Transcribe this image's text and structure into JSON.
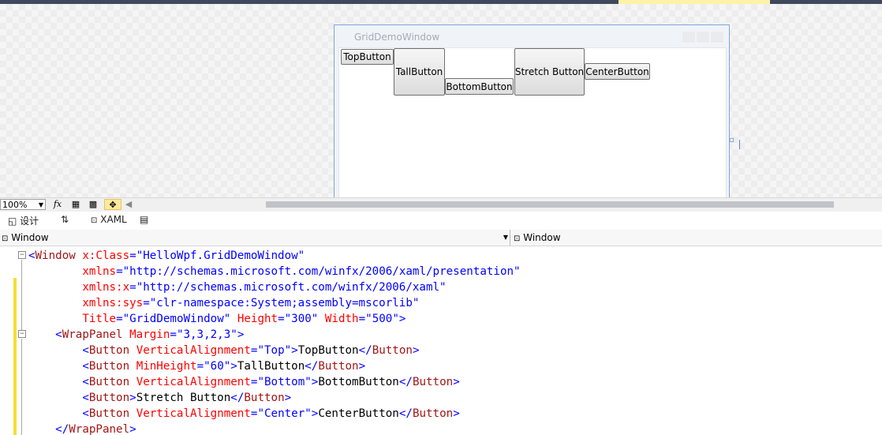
{
  "designer": {
    "window_title": "GridDemoWindow",
    "buttons": [
      {
        "label": "TopButton"
      },
      {
        "label": "TallButton"
      },
      {
        "label": "BottomButton"
      },
      {
        "label": "Stretch Button"
      },
      {
        "label": "CenterButton"
      }
    ]
  },
  "zoom": {
    "value": "100%",
    "fx_icon": "fx"
  },
  "tabs": {
    "design": "设计",
    "swap_icon": "⇅",
    "xaml": "XAML"
  },
  "navbar": {
    "left": "Window",
    "right": "Window"
  },
  "colors": {
    "tag": "#a31515",
    "attr": "#ff0000",
    "bracket": "#0000ff",
    "changebar": "#f2e033"
  },
  "code": {
    "l1": {
      "tag": "Window",
      "attr": "x:Class",
      "val": "\"HelloWpf.GridDemoWindow\""
    },
    "l2": {
      "attr": "xmlns",
      "val": "\"http://schemas.microsoft.com/winfx/2006/xaml/presentation\""
    },
    "l3": {
      "attr": "xmlns:x",
      "val": "\"http://schemas.microsoft.com/winfx/2006/xaml\""
    },
    "l4": {
      "attr": "xmlns:sys",
      "val": "\"clr-namespace:System;assembly=mscorlib\""
    },
    "l5": {
      "a1": "Title",
      "v1": "\"GridDemoWindow\"",
      "a2": "Height",
      "v2": "\"300\"",
      "a3": "Width",
      "v3": "\"500\""
    },
    "l6": {
      "tag": "WrapPanel",
      "attr": "Margin",
      "val": "\"3,3,2,3\""
    },
    "l7": {
      "tag": "Button",
      "attr": "VerticalAlignment",
      "val": "\"Top\"",
      "text": "TopButton"
    },
    "l8": {
      "tag": "Button",
      "attr": "MinHeight",
      "val": "\"60\"",
      "text": "TallButton"
    },
    "l9": {
      "tag": "Button",
      "attr": "VerticalAlignment",
      "val": "\"Bottom\"",
      "text": "BottomButton"
    },
    "l10": {
      "tag": "Button",
      "text": "Stretch Button"
    },
    "l11": {
      "tag": "Button",
      "attr": "VerticalAlignment",
      "val": "\"Center\"",
      "text": "CenterButton"
    },
    "l12": {
      "tag": "WrapPanel"
    }
  }
}
